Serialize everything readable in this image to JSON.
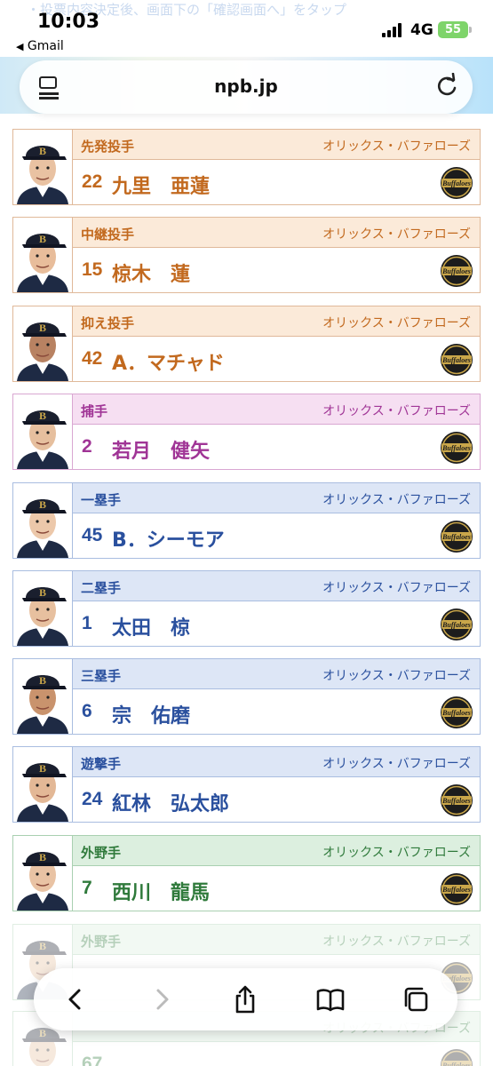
{
  "status_bar": {
    "time": "10:03",
    "back_app": "Gmail",
    "network": "4G",
    "battery": "55",
    "top_hint": "・投票内容決定後、画面下の「確認画面へ」をタップ"
  },
  "address_bar": {
    "url": "npb.jp",
    "menu_icon": "page-menu-icon",
    "reload_icon": "reload-icon"
  },
  "team_name": "オリックス・バファローズ",
  "players": [
    {
      "position": "先発投手",
      "number": "22",
      "name": "九里　亜蓮",
      "group": "pitch"
    },
    {
      "position": "中継投手",
      "number": "15",
      "name": "椋木　蓮",
      "group": "pitch"
    },
    {
      "position": "抑え投手",
      "number": "42",
      "name": "A．マチャド",
      "group": "pitch"
    },
    {
      "position": "捕手",
      "number": "2",
      "name": "若月　健矢",
      "group": "catch"
    },
    {
      "position": "一塁手",
      "number": "45",
      "name": "B．シーモア",
      "group": "inf"
    },
    {
      "position": "二塁手",
      "number": "1",
      "name": "太田　椋",
      "group": "inf"
    },
    {
      "position": "三塁手",
      "number": "6",
      "name": "宗　佑磨",
      "group": "inf"
    },
    {
      "position": "遊撃手",
      "number": "24",
      "name": "紅林　弘太郎",
      "group": "inf"
    },
    {
      "position": "外野手",
      "number": "7",
      "name": "西川　龍馬",
      "group": "of"
    },
    {
      "position": "外野手",
      "number": "",
      "name": "",
      "group": "of"
    },
    {
      "position": "",
      "number": "67",
      "name": "",
      "group": "of"
    }
  ],
  "colors": {
    "pitch": "#c2691e",
    "catch": "#a03596",
    "infield": "#2a509e",
    "outfield": "#2f7a3b"
  },
  "toolbar": {
    "back_icon": "chevron-left-icon",
    "forward_icon": "chevron-right-icon",
    "share_icon": "share-icon",
    "bookmarks_icon": "book-icon",
    "tabs_icon": "tabs-icon"
  }
}
